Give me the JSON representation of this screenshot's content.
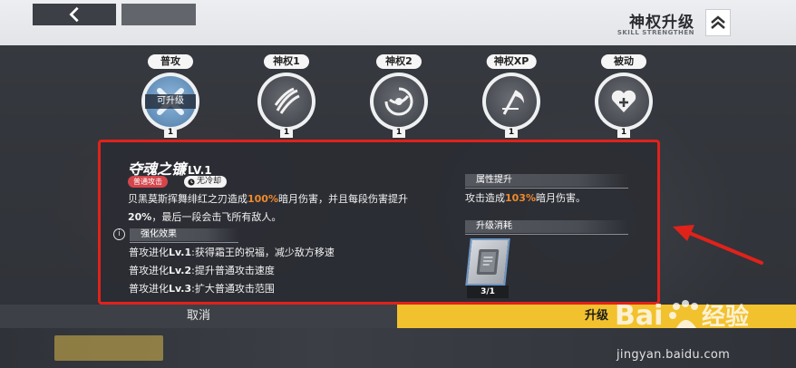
{
  "header": {
    "title": "神权升级",
    "subtitle": "SKILL STRENGTHEN"
  },
  "skill_tabs": [
    {
      "label": "普攻",
      "level": "1",
      "badge": "可升级",
      "icon": "crossed-blades-icon",
      "active": true
    },
    {
      "label": "神权1",
      "level": "1",
      "icon": "claw-slash-icon"
    },
    {
      "label": "神权2",
      "level": "1",
      "icon": "spiral-slash-icon"
    },
    {
      "label": "神权XP",
      "level": "1",
      "icon": "scythe-icon"
    },
    {
      "label": "被动",
      "level": "1",
      "icon": "heart-shield-icon"
    }
  ],
  "detail": {
    "name": "夺魂之镰",
    "level": "LV.1",
    "type_tag": "普通攻击",
    "cooldown_tag": "无冷却",
    "desc_parts": {
      "p1": "贝黑莫斯挥舞绯红之刃造成",
      "p2": "100%",
      "p3": "暗月伤害，并且每段伤害提升",
      "p4": "20%",
      "p5": "，最后一段会击飞所有敌人。"
    },
    "enhance_header": "强化效果",
    "enhance_items": [
      {
        "prefix": "普攻进化",
        "lv": "Lv.1",
        "text": ":获得霜王的祝福，减少敌方移速"
      },
      {
        "prefix": "普攻进化",
        "lv": "Lv.2",
        "text": ":提升普通攻击速度"
      },
      {
        "prefix": "普攻进化",
        "lv": "Lv.3",
        "text": ":扩大普通攻击范围"
      }
    ],
    "attr_header": "属性提升",
    "attr_parts": {
      "p1": "攻击造成",
      "p2": "103%",
      "p3": "暗月伤害。"
    },
    "cost_header": "升级消耗",
    "cost_item": {
      "icon": "book-icon",
      "count": "3/1"
    }
  },
  "buttons": {
    "cancel": "取消",
    "upgrade": "升级"
  },
  "watermark": {
    "logo": "Baidu经验",
    "url": "jingyan.baidu.com"
  },
  "colors": {
    "highlight": "#ee8a2c",
    "upgrade_button": "#f2c12e",
    "annotation_red": "#e0221b"
  }
}
